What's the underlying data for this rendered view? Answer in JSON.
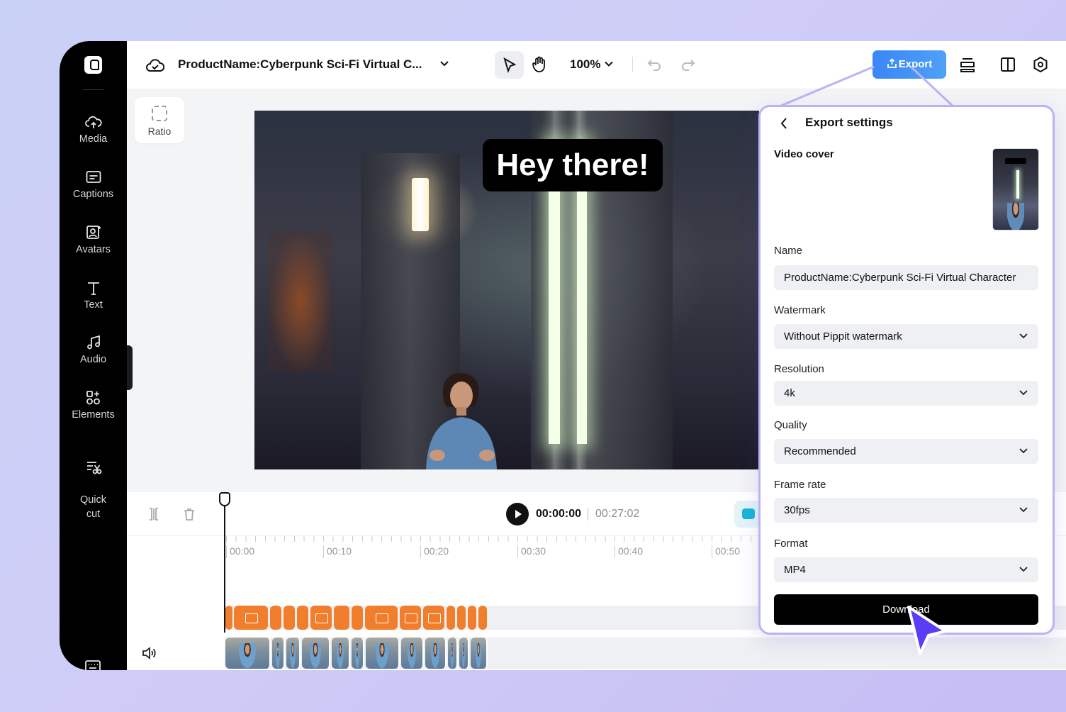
{
  "sidebar": {
    "items": [
      {
        "label": "Media",
        "icon": "cloud-upload-icon"
      },
      {
        "label": "Captions",
        "icon": "captions-icon"
      },
      {
        "label": "Avatars",
        "icon": "avatar-icon"
      },
      {
        "label": "Text",
        "icon": "text-icon"
      },
      {
        "label": "Audio",
        "icon": "music-note-icon"
      },
      {
        "label": "Elements",
        "icon": "elements-icon"
      },
      {
        "label": "Quick\ncut",
        "icon": "quick-cut-icon"
      }
    ]
  },
  "topbar": {
    "project_title": "ProductName:Cyberpunk Sci-Fi Virtual C...",
    "zoom": "100%",
    "export_label": "Export"
  },
  "canvas": {
    "ratio_label": "Ratio",
    "caption_text": "Hey there!"
  },
  "timeline": {
    "current_time": "00:00:00",
    "total_time": "00:27:02",
    "ruler_labels": [
      "00:00",
      "00:10",
      "00:20",
      "00:30",
      "00:40",
      "00:50"
    ]
  },
  "export_panel": {
    "title": "Export settings",
    "video_cover_label": "Video cover",
    "name_label": "Name",
    "name_value": "ProductName:Cyberpunk Sci-Fi Virtual Character",
    "watermark_label": "Watermark",
    "watermark_value": "Without Pippit watermark",
    "resolution_label": "Resolution",
    "resolution_value": "4k",
    "quality_label": "Quality",
    "quality_value": "Recommended",
    "frame_rate_label": "Frame rate",
    "frame_rate_value": "30fps",
    "format_label": "Format",
    "format_value": "MP4",
    "download_label": "Download"
  },
  "colors": {
    "export_button": "#3a86f7",
    "caption_clip": "#f07e2c",
    "panel_border": "#b9b3f6",
    "cursor": "#5b3df5"
  }
}
